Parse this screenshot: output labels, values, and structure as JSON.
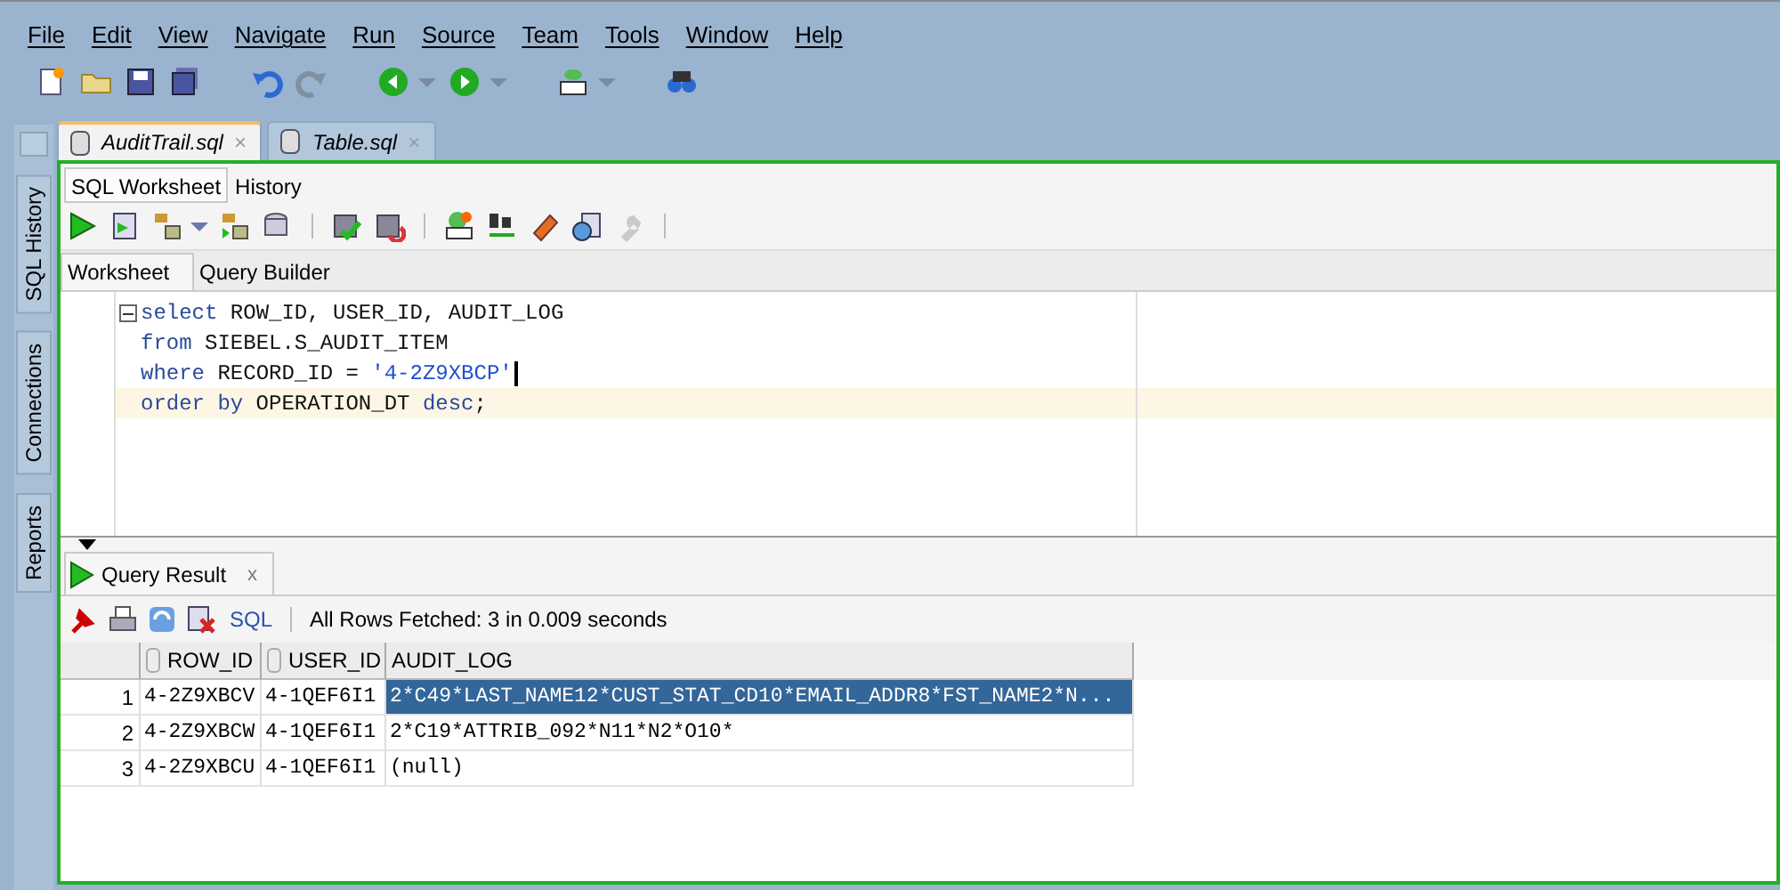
{
  "menu": [
    "File",
    "Edit",
    "View",
    "Navigate",
    "Run",
    "Source",
    "Team",
    "Tools",
    "Window",
    "Help"
  ],
  "main_toolbar": [
    {
      "disabled": false
    },
    {
      "disabled": false
    },
    {
      "disabled": false
    },
    {
      "disabled": false
    },
    {
      "disabled": false
    },
    {
      "disabled": true
    },
    {
      "disabled": false
    },
    {
      "disabled": false
    },
    {
      "disabled": false
    },
    {
      "disabled": false
    }
  ],
  "side_tabs": [
    "SQL History",
    "Connections",
    "Reports"
  ],
  "file_tabs": [
    {
      "label": "AuditTrail.sql",
      "selected": true,
      "close": "×"
    },
    {
      "label": "Table.sql",
      "selected": false,
      "close": "×"
    }
  ],
  "sub_tabs": [
    {
      "label": "SQL Worksheet",
      "selected": true
    },
    {
      "label": "History",
      "selected": false
    }
  ],
  "worksheet_toolbar": [
    {
      "disabled": false
    },
    {
      "disabled": false
    },
    {
      "disabled": false
    },
    {
      "disabled": false
    },
    {
      "disabled": false
    },
    {
      "disabled": false
    },
    {
      "disabled": false
    },
    {
      "disabled": false
    },
    {
      "disabled": false
    },
    {
      "disabled": false
    },
    {
      "disabled": false
    },
    {
      "disabled": true
    }
  ],
  "editor_tabs": [
    {
      "label": "Worksheet",
      "selected": true
    },
    {
      "label": "Query Builder",
      "selected": false
    }
  ],
  "code": [
    {
      "current": false,
      "tokens": [
        {
          "kind": "keyword",
          "text": "select"
        },
        {
          "kind": "ident",
          "text": " ROW_ID, USER_ID, AUDIT_LOG"
        }
      ]
    },
    {
      "current": false,
      "tokens": [
        {
          "kind": "keyword",
          "text": "from"
        },
        {
          "kind": "ident",
          "text": " SIEBEL.S_AUDIT_ITEM"
        }
      ]
    },
    {
      "current": false,
      "tokens": [
        {
          "kind": "keyword",
          "text": "where"
        },
        {
          "kind": "ident",
          "text": " RECORD_ID = "
        },
        {
          "kind": "string",
          "text": "'4-2Z9XBCP'"
        }
      ]
    },
    {
      "current": true,
      "tokens": [
        {
          "kind": "keyword",
          "text": "order by"
        },
        {
          "kind": "ident",
          "text": " OPERATION_DT "
        },
        {
          "kind": "keyword",
          "text": "desc"
        },
        {
          "kind": "ident",
          "text": ";"
        }
      ]
    }
  ],
  "result_tab": {
    "label": "Query Result",
    "close": "x"
  },
  "result_toolbar": {
    "sql_link": "SQL",
    "status": "All Rows Fetched: 3 in 0.009 seconds"
  },
  "table": {
    "columns": [
      "ROW_ID",
      "USER_ID",
      "AUDIT_LOG"
    ],
    "rows": [
      {
        "number": "1",
        "selected": true,
        "cells": [
          "4-2Z9XBCV",
          "4-1QEF6I1",
          "2*C49*LAST_NAME12*CUST_STAT_CD10*EMAIL_ADDR8*FST_NAME2*N..."
        ]
      },
      {
        "number": "2",
        "selected": false,
        "cells": [
          "4-2Z9XBCW",
          "4-1QEF6I1",
          "2*C19*ATTRIB_092*N11*N2*O10*"
        ]
      },
      {
        "number": "3",
        "selected": false,
        "cells": [
          "4-2Z9XBCU",
          "4-1QEF6I1",
          "(null)"
        ]
      }
    ]
  }
}
